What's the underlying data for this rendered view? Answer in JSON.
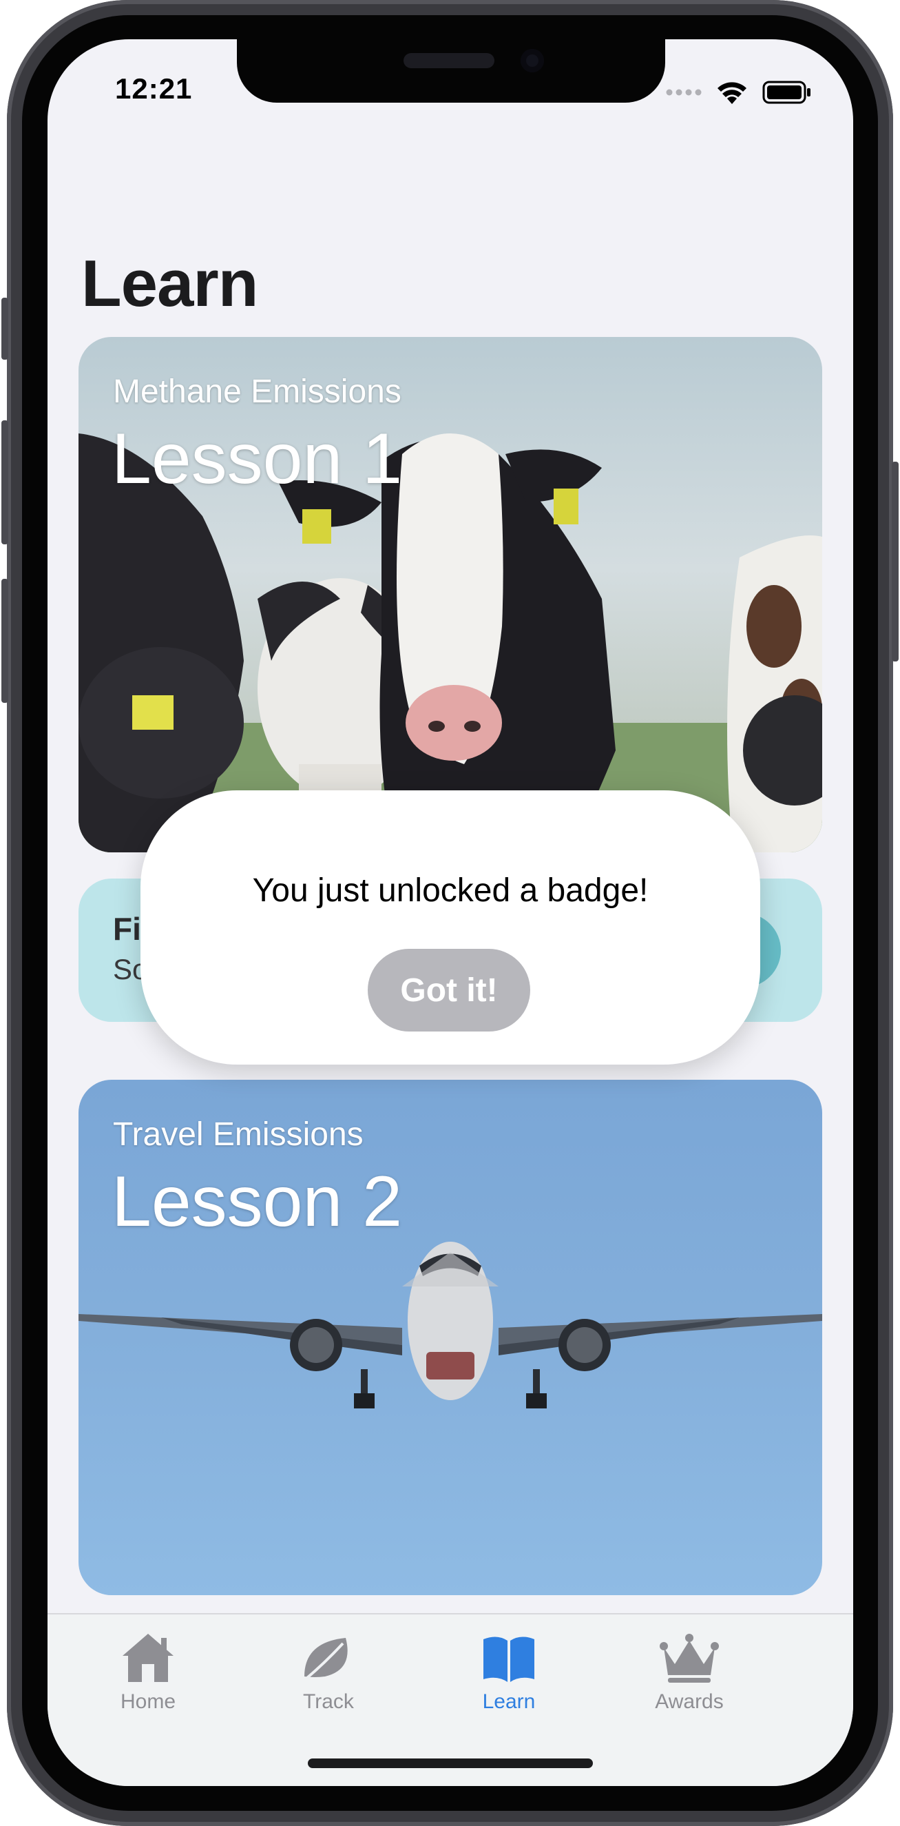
{
  "status_bar": {
    "time": "12:21"
  },
  "page": {
    "title": "Learn"
  },
  "cards": [
    {
      "kicker": "Methane Emissions",
      "lesson": "Lesson 1"
    },
    {
      "title": "Fi",
      "subtitle": "So"
    },
    {
      "kicker": "Travel Emissions",
      "lesson": "Lesson 2"
    }
  ],
  "modal": {
    "message": "You just unlocked a badge!",
    "button_label": "Got it!"
  },
  "tabbar": {
    "items": [
      {
        "label": "Home",
        "icon": "house-icon"
      },
      {
        "label": "Track",
        "icon": "leaf-icon"
      },
      {
        "label": "Learn",
        "icon": "book-icon",
        "active": true
      },
      {
        "label": "Awards",
        "icon": "crown-icon"
      }
    ]
  },
  "colors": {
    "accent": "#2f7fe0",
    "inactive_tab": "#8e8e93",
    "button_disabled": "#b7b7bc"
  }
}
